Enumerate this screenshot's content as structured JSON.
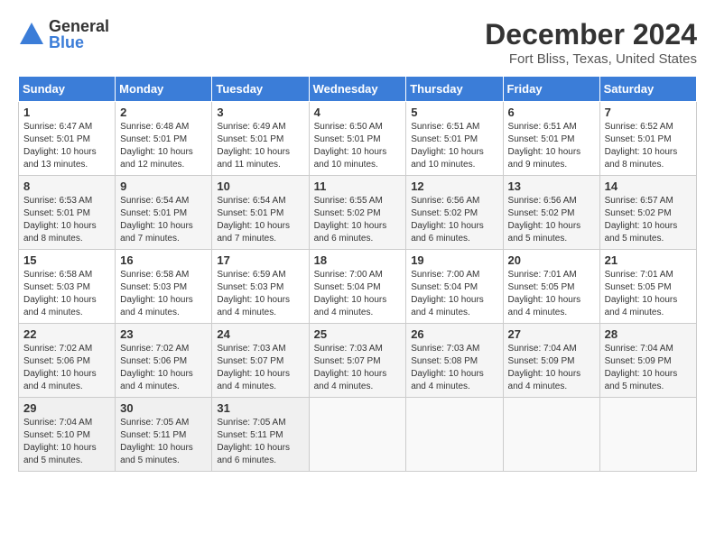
{
  "header": {
    "logo_general": "General",
    "logo_blue": "Blue",
    "title": "December 2024",
    "location": "Fort Bliss, Texas, United States"
  },
  "days_of_week": [
    "Sunday",
    "Monday",
    "Tuesday",
    "Wednesday",
    "Thursday",
    "Friday",
    "Saturday"
  ],
  "weeks": [
    [
      {
        "day": "1",
        "sunrise": "6:47 AM",
        "sunset": "5:01 PM",
        "daylight": "10 hours and 13 minutes."
      },
      {
        "day": "2",
        "sunrise": "6:48 AM",
        "sunset": "5:01 PM",
        "daylight": "10 hours and 12 minutes."
      },
      {
        "day": "3",
        "sunrise": "6:49 AM",
        "sunset": "5:01 PM",
        "daylight": "10 hours and 11 minutes."
      },
      {
        "day": "4",
        "sunrise": "6:50 AM",
        "sunset": "5:01 PM",
        "daylight": "10 hours and 10 minutes."
      },
      {
        "day": "5",
        "sunrise": "6:51 AM",
        "sunset": "5:01 PM",
        "daylight": "10 hours and 10 minutes."
      },
      {
        "day": "6",
        "sunrise": "6:51 AM",
        "sunset": "5:01 PM",
        "daylight": "10 hours and 9 minutes."
      },
      {
        "day": "7",
        "sunrise": "6:52 AM",
        "sunset": "5:01 PM",
        "daylight": "10 hours and 8 minutes."
      }
    ],
    [
      {
        "day": "8",
        "sunrise": "6:53 AM",
        "sunset": "5:01 PM",
        "daylight": "10 hours and 8 minutes."
      },
      {
        "day": "9",
        "sunrise": "6:54 AM",
        "sunset": "5:01 PM",
        "daylight": "10 hours and 7 minutes."
      },
      {
        "day": "10",
        "sunrise": "6:54 AM",
        "sunset": "5:01 PM",
        "daylight": "10 hours and 7 minutes."
      },
      {
        "day": "11",
        "sunrise": "6:55 AM",
        "sunset": "5:02 PM",
        "daylight": "10 hours and 6 minutes."
      },
      {
        "day": "12",
        "sunrise": "6:56 AM",
        "sunset": "5:02 PM",
        "daylight": "10 hours and 6 minutes."
      },
      {
        "day": "13",
        "sunrise": "6:56 AM",
        "sunset": "5:02 PM",
        "daylight": "10 hours and 5 minutes."
      },
      {
        "day": "14",
        "sunrise": "6:57 AM",
        "sunset": "5:02 PM",
        "daylight": "10 hours and 5 minutes."
      }
    ],
    [
      {
        "day": "15",
        "sunrise": "6:58 AM",
        "sunset": "5:03 PM",
        "daylight": "10 hours and 4 minutes."
      },
      {
        "day": "16",
        "sunrise": "6:58 AM",
        "sunset": "5:03 PM",
        "daylight": "10 hours and 4 minutes."
      },
      {
        "day": "17",
        "sunrise": "6:59 AM",
        "sunset": "5:03 PM",
        "daylight": "10 hours and 4 minutes."
      },
      {
        "day": "18",
        "sunrise": "7:00 AM",
        "sunset": "5:04 PM",
        "daylight": "10 hours and 4 minutes."
      },
      {
        "day": "19",
        "sunrise": "7:00 AM",
        "sunset": "5:04 PM",
        "daylight": "10 hours and 4 minutes."
      },
      {
        "day": "20",
        "sunrise": "7:01 AM",
        "sunset": "5:05 PM",
        "daylight": "10 hours and 4 minutes."
      },
      {
        "day": "21",
        "sunrise": "7:01 AM",
        "sunset": "5:05 PM",
        "daylight": "10 hours and 4 minutes."
      }
    ],
    [
      {
        "day": "22",
        "sunrise": "7:02 AM",
        "sunset": "5:06 PM",
        "daylight": "10 hours and 4 minutes."
      },
      {
        "day": "23",
        "sunrise": "7:02 AM",
        "sunset": "5:06 PM",
        "daylight": "10 hours and 4 minutes."
      },
      {
        "day": "24",
        "sunrise": "7:03 AM",
        "sunset": "5:07 PM",
        "daylight": "10 hours and 4 minutes."
      },
      {
        "day": "25",
        "sunrise": "7:03 AM",
        "sunset": "5:07 PM",
        "daylight": "10 hours and 4 minutes."
      },
      {
        "day": "26",
        "sunrise": "7:03 AM",
        "sunset": "5:08 PM",
        "daylight": "10 hours and 4 minutes."
      },
      {
        "day": "27",
        "sunrise": "7:04 AM",
        "sunset": "5:09 PM",
        "daylight": "10 hours and 4 minutes."
      },
      {
        "day": "28",
        "sunrise": "7:04 AM",
        "sunset": "5:09 PM",
        "daylight": "10 hours and 5 minutes."
      }
    ],
    [
      {
        "day": "29",
        "sunrise": "7:04 AM",
        "sunset": "5:10 PM",
        "daylight": "10 hours and 5 minutes."
      },
      {
        "day": "30",
        "sunrise": "7:05 AM",
        "sunset": "5:11 PM",
        "daylight": "10 hours and 5 minutes."
      },
      {
        "day": "31",
        "sunrise": "7:05 AM",
        "sunset": "5:11 PM",
        "daylight": "10 hours and 6 minutes."
      },
      null,
      null,
      null,
      null
    ]
  ]
}
